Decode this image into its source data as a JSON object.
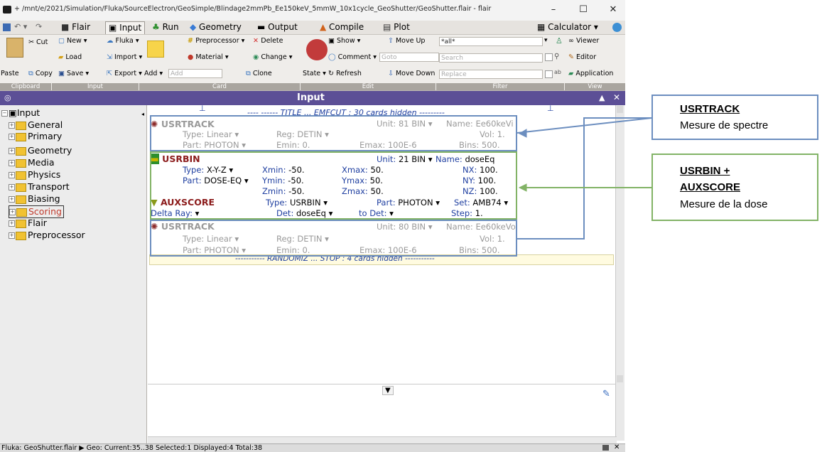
{
  "window": {
    "title": "+ /mnt/e/2021/Simulation/Fluka/SourceElectron/GeoSimple/Blindage2mmPb_Ee150keV_5mmW_10x1cycle_GeoShutter/GeoShutter.flair - flair",
    "minimize": "–",
    "maximize": "☐",
    "close": "✕"
  },
  "menu": {
    "tabs": [
      "Flair",
      "Input",
      "Run",
      "Geometry",
      "Output",
      "Compile",
      "Plot"
    ],
    "calculator": "Calculator"
  },
  "toolbar": {
    "cut": "Cut",
    "copy": "Copy",
    "paste": "Paste",
    "new": "New",
    "load": "Load",
    "save": "Save",
    "fluka": "Fluka",
    "import": "Import",
    "export": "Export",
    "add": "Add",
    "add_placeholder": "Add",
    "preprocessor": "Preprocessor",
    "material": "Material",
    "delete": "Delete",
    "change": "Change",
    "clone": "Clone",
    "state": "State",
    "show": "Show",
    "comment": "Comment",
    "refresh": "Refresh",
    "move_up": "Move Up",
    "move_down": "Move Down",
    "goto_placeholder": "Goto",
    "filter_value": "*all*",
    "search_placeholder": "Search",
    "replace_placeholder": "Replace",
    "viewer": "Viewer",
    "editor": "Editor",
    "application": "Application",
    "groups": [
      "Clipboard",
      "Input",
      "Card",
      "Edit",
      "Filter",
      "View"
    ]
  },
  "panel": {
    "title": "Input"
  },
  "tree": {
    "root": "Input",
    "items": [
      "General",
      "Primary",
      "Geometry",
      "Media",
      "Physics",
      "Transport",
      "Biasing",
      "Scoring",
      "Flair",
      "Preprocessor"
    ],
    "selected": "Scoring"
  },
  "editor": {
    "top_hidden": "---- ------ TITLE ... EMFCUT : 30 cards hidden ---------",
    "cards": {
      "usrtrack1": {
        "name": "USRTRACK",
        "type": "Type: Linear ▾",
        "reg": "Reg: DETIN ▾",
        "unit": "Unit: 81 BIN ▾",
        "nm": "Name: Ee60keVi",
        "vol": "Vol: 1.",
        "part": "Part: PHOTON ▾",
        "emin": "Emin: 0.",
        "emax": "Emax: 100E-6",
        "bins": "Bins: 500."
      },
      "usrbin": {
        "name": "USRBIN",
        "unit_lbl": "Unit:",
        "unit_val": "21 BIN ▾",
        "name_lbl": "Name:",
        "name_val": "doseEq",
        "type_lbl": "Type:",
        "type_val": "X-Y-Z ▾",
        "xmin_lbl": "Xmin:",
        "xmin_val": "-50.",
        "xmax_lbl": "Xmax:",
        "xmax_val": "50.",
        "nx_lbl": "NX:",
        "nx_val": "100.",
        "part_lbl": "Part:",
        "part_val": "DOSE-EQ ▾",
        "ymin_lbl": "Ymin:",
        "ymin_val": "-50.",
        "ymax_lbl": "Ymax:",
        "ymax_val": "50.",
        "ny_lbl": "NY:",
        "ny_val": "100.",
        "zmin_lbl": "Zmin:",
        "zmin_val": "-50.",
        "zmax_lbl": "Zmax:",
        "zmax_val": "50.",
        "nz_lbl": "NZ:",
        "nz_val": "100."
      },
      "auxscore": {
        "name": "AUXSCORE",
        "type_lbl": "Type:",
        "type_val": "USRBIN ▾",
        "part_lbl": "Part:",
        "part_val": "PHOTON ▾",
        "set_lbl": "Set:",
        "set_val": "AMB74 ▾",
        "delta_lbl": "Delta Ray:",
        "delta_val": "▾",
        "det_lbl": "Det:",
        "det_val": "doseEq ▾",
        "todet_lbl": "to Det:",
        "todet_val": "▾",
        "step_lbl": "Step:",
        "step_val": "1."
      },
      "usrtrack2": {
        "name": "USRTRACK",
        "type": "Type: Linear ▾",
        "reg": "Reg: DETIN ▾",
        "unit": "Unit: 80 BIN ▾",
        "nm": "Name: Ee60keVo",
        "vol": "Vol: 1.",
        "part": "Part: PHOTON ▾",
        "emin": "Emin: 0.",
        "emax": "Emax: 100E-6",
        "bins": "Bins: 500."
      }
    },
    "bottom_hidden": "----------- RANDOMIZ ... STOP : 4 cards hidden -----------"
  },
  "status": "Fluka: GeoShutter.flair ▶ Geo: Current:35..38 Selected:1 Displayed:4 Total:38",
  "annotations": {
    "box1_title": "USRTRACK",
    "box1_text": "Mesure de spectre",
    "box2_title_1": "USRBIN +",
    "box2_title_2": "AUXSCORE",
    "box2_text": "Mesure de la dose",
    "blue": "#6c8ebf",
    "green": "#82b366"
  }
}
